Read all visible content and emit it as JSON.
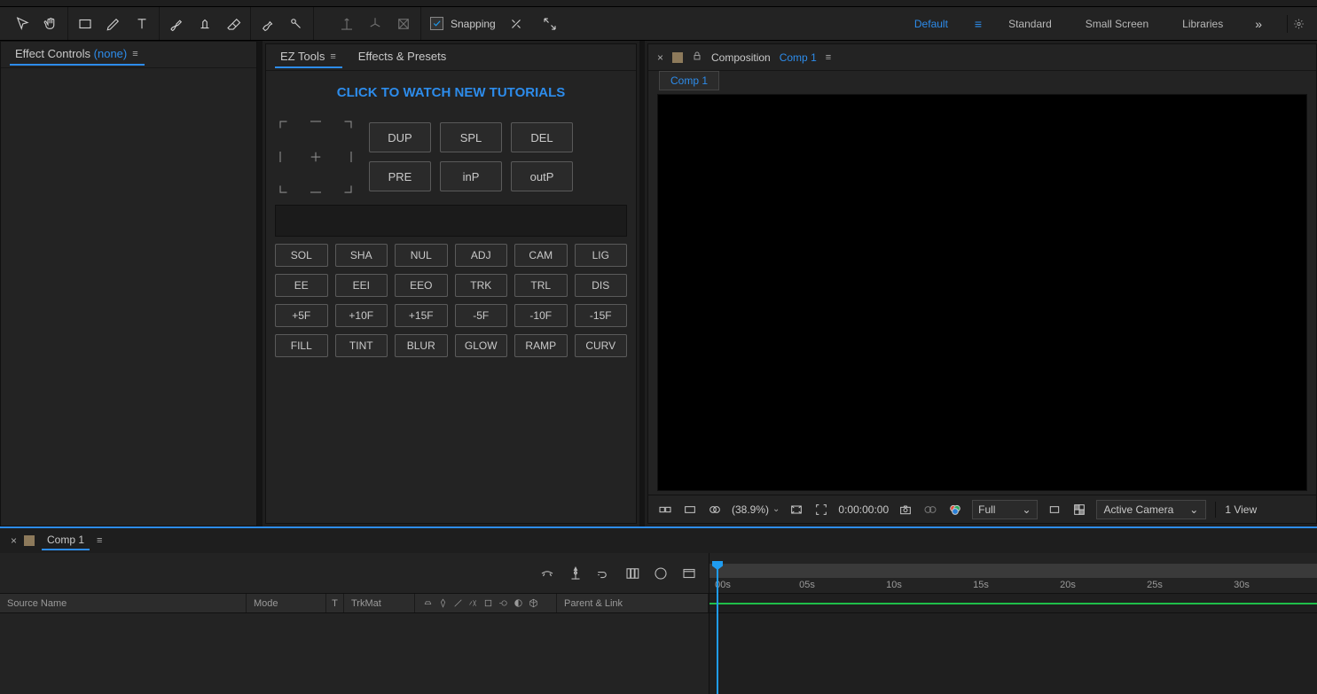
{
  "toolbar": {
    "snapping_label": "Snapping"
  },
  "workspaces": {
    "items": [
      "Default",
      "Standard",
      "Small Screen",
      "Libraries"
    ],
    "active_index": 0,
    "overflow_glyph": "»"
  },
  "panels": {
    "effect_controls": {
      "title": "Effect Controls",
      "suffix": "(none)"
    },
    "ez_tools": {
      "title": "EZ Tools",
      "effects_presets_title": "Effects & Presets",
      "link_text": "CLICK TO WATCH NEW TUTORIALS",
      "big_buttons": [
        "DUP",
        "SPL",
        "DEL",
        "PRE",
        "inP",
        "outP"
      ],
      "rows": [
        [
          "SOL",
          "SHA",
          "NUL",
          "ADJ",
          "CAM",
          "LIG"
        ],
        [
          "EE",
          "EEI",
          "EEO",
          "TRK",
          "TRL",
          "DIS"
        ],
        [
          "+5F",
          "+10F",
          "+15F",
          "-5F",
          "-10F",
          "-15F"
        ],
        [
          "FILL",
          "TINT",
          "BLUR",
          "GLOW",
          "RAMP",
          "CURV"
        ]
      ]
    },
    "composition": {
      "label": "Composition",
      "name": "Comp 1",
      "breadcrumb": "Comp 1"
    }
  },
  "viewer_footer": {
    "zoom": "(38.9%)",
    "timecode": "0:00:00:00",
    "resolution": "Full",
    "camera": "Active Camera",
    "views": "1 View"
  },
  "timeline": {
    "tab_name": "Comp 1",
    "columns": {
      "source": "Source Name",
      "mode": "Mode",
      "t": "T",
      "trkmat": "TrkMat",
      "parent": "Parent & Link"
    },
    "ticks": [
      "00s",
      "05s",
      "10s",
      "15s",
      "20s",
      "25s",
      "30s"
    ]
  }
}
